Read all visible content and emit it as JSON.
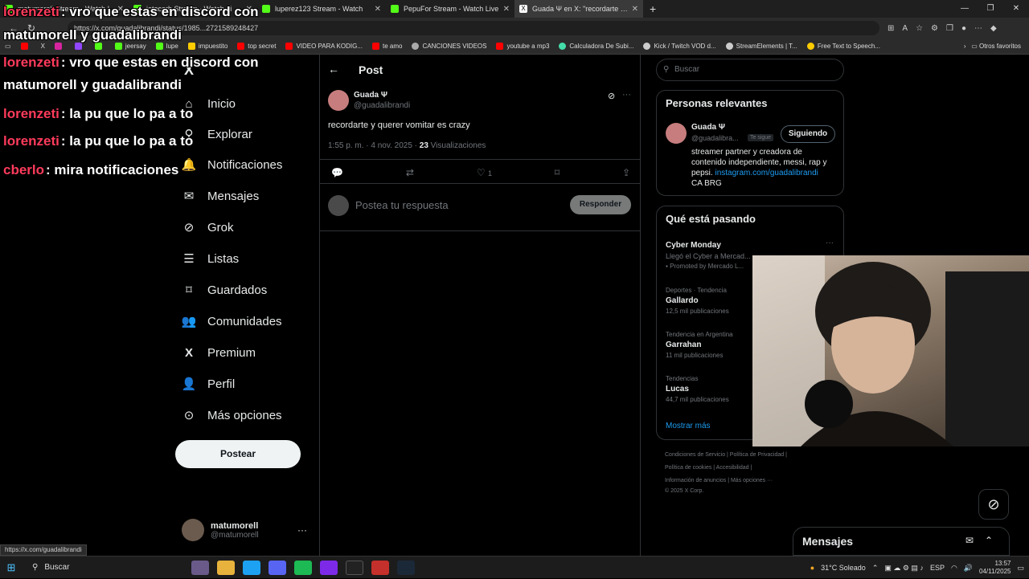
{
  "browser": {
    "tabs": [
      {
        "title": "matumorell Stream - Watch L",
        "color": "#53fc18",
        "active": false
      },
      {
        "title": "jotacarb Stream - Watch Li",
        "color": "#53fc18",
        "active": false
      },
      {
        "title": "luperez123 Stream - Watch",
        "color": "#53fc18",
        "active": false
      },
      {
        "title": "PepuFor Stream - Watch Live",
        "color": "#53fc18",
        "active": false
      },
      {
        "title": "Guada Ψ en X: \"recordarte y quer",
        "color": "#ffffff",
        "active": true
      }
    ],
    "url": "https://x.com/guadalibrandi/status/1985...2721589248427",
    "bookmarks": [
      {
        "label": "jeersay",
        "color": "#53fc18"
      },
      {
        "label": "lupe",
        "color": "#53fc18"
      },
      {
        "label": "impuestito",
        "color": "#ffcc00"
      },
      {
        "label": "top secret",
        "color": "#ff0000"
      },
      {
        "label": "VIDEO PARA KODIG...",
        "color": "#ff0000"
      },
      {
        "label": "te amo",
        "color": "#ff0000"
      },
      {
        "label": "CANCIONES VIDEOS",
        "color": "#aaaaaa"
      },
      {
        "label": "youtube a mp3",
        "color": "#ff0000"
      },
      {
        "label": "Calculadora De Subi...",
        "color": "#44ddaa"
      },
      {
        "label": "Kick / Twitch VOD d...",
        "color": "#cccccc"
      },
      {
        "label": "StreamElements | T...",
        "color": "#cccccc"
      },
      {
        "label": "Free Text to Speech...",
        "color": "#ffcc00"
      }
    ],
    "other_bookmarks": "Otros favoritos",
    "status_url": "https://x.com/guadalibrandi"
  },
  "chat": [
    {
      "user": "lorenzeti",
      "text": ": vro que estas en discord con",
      "color": "#ff3b5c"
    },
    {
      "user": "",
      "text": "matumorell y guadalibrandi",
      "color": "#ffffff"
    },
    {
      "user": "lorenzeti",
      "text": ": la pu que lo pa a to",
      "color": "#ff3b5c"
    },
    {
      "user": "lorenzeti",
      "text": ": la pu que lo pa a to",
      "color": "#ff3b5c"
    },
    {
      "user": "cberlo",
      "text": ": mira notificaciones",
      "color": "#ff3b5c"
    }
  ],
  "sidebar": {
    "items": [
      {
        "label": "Inicio",
        "icon": "home-icon"
      },
      {
        "label": "Explorar",
        "icon": "search-icon"
      },
      {
        "label": "Notificaciones",
        "icon": "bell-icon"
      },
      {
        "label": "Mensajes",
        "icon": "mail-icon"
      },
      {
        "label": "Grok",
        "icon": "grok-icon"
      },
      {
        "label": "Listas",
        "icon": "list-icon"
      },
      {
        "label": "Guardados",
        "icon": "bookmark-icon"
      },
      {
        "label": "Comunidades",
        "icon": "community-icon"
      },
      {
        "label": "Premium",
        "icon": "x-logo-icon"
      },
      {
        "label": "Perfil",
        "icon": "person-icon"
      },
      {
        "label": "Más opciones",
        "icon": "more-circle-icon"
      }
    ],
    "post_button": "Postear",
    "account": {
      "name": "matumorell",
      "handle": "@matumorell"
    }
  },
  "post": {
    "header": "Post",
    "author_name": "Guada Ψ",
    "author_handle": "@guadalibrandi",
    "text": "recordarte y querer vomitar es crazy",
    "time": "1:55 p. m. · 4 nov. 2025 · ",
    "views_count": "23",
    "views_label": " Visualizaciones",
    "likes": "1",
    "reply_placeholder": "Postea tu respuesta",
    "reply_button": "Responder"
  },
  "right": {
    "search_placeholder": "Buscar",
    "relevant": {
      "title": "Personas relevantes",
      "name": "Guada Ψ",
      "handle": "@guadalibra...",
      "badge": "Te sigue",
      "follow": "Siguiendo",
      "bio": "streamer partner y creadora de contenido independiente, messi, rap y pepsi. ",
      "bio_link": "instagram.com/guadalibrandi",
      "bio_tail": "CA BRG"
    },
    "trends_title": "Qué está pasando",
    "trends": [
      {
        "ctx": "",
        "name": "Cyber Monday",
        "count": "Llegó el Cyber a Mercad...",
        "promo": "Promoted by Mercado L..."
      },
      {
        "ctx": "Deportes · Tendencia",
        "name": "Gallardo",
        "count": "12,5 mil publicaciones",
        "promo": ""
      },
      {
        "ctx": "Tendencia en Argentina",
        "name": "Garrahan",
        "count": "11 mil publicaciones",
        "promo": ""
      },
      {
        "ctx": "Tendencias",
        "name": "Lucas",
        "count": "44,7 mil publicaciones",
        "promo": ""
      }
    ],
    "show_more": "Mostrar más",
    "footer": {
      "line1": "Condiciones de Servicio  |  Política de Privacidad  |",
      "line2": "Política de cookies  |  Accesibilidad  |",
      "line3": "Información de anuncios  |  Más opciones ···",
      "line4": "© 2025 X Corp."
    }
  },
  "messages_drawer": "Mensajes",
  "taskbar": {
    "search": "Buscar",
    "weather": "31°C  Soleado",
    "lang": "ESP",
    "time": "13:57",
    "date": "04/11/2025"
  }
}
